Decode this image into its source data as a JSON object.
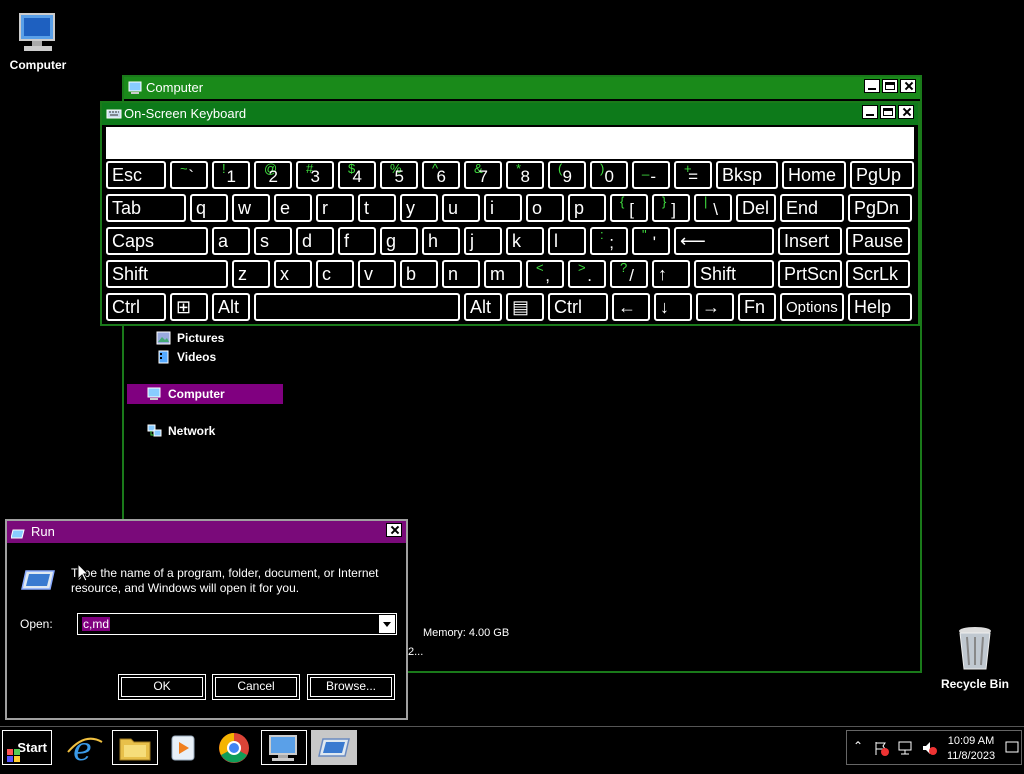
{
  "desktop": {
    "icons": [
      {
        "label": "Computer"
      },
      {
        "label": "Recycle Bin"
      }
    ]
  },
  "explorer": {
    "title": "Computer",
    "nav": {
      "pictures": "Pictures",
      "videos": "Videos",
      "computer": "Computer",
      "network": "Network"
    },
    "details": {
      "memory": "Memory: 4.00 GB",
      "partial": "2..."
    }
  },
  "osk": {
    "title": "On-Screen Keyboard",
    "rows": [
      [
        {
          "main": "Esc"
        },
        {
          "alt": "~",
          "main": "`"
        },
        {
          "alt": "!",
          "main": "1"
        },
        {
          "alt": "@",
          "main": "2"
        },
        {
          "alt": "#",
          "main": "3"
        },
        {
          "alt": "$",
          "main": "4"
        },
        {
          "alt": "%",
          "main": "5"
        },
        {
          "alt": "^",
          "main": "6"
        },
        {
          "alt": "&",
          "main": "7"
        },
        {
          "alt": "*",
          "main": "8"
        },
        {
          "alt": "(",
          "main": "9"
        },
        {
          "alt": ")",
          "main": "0"
        },
        {
          "alt": "_",
          "main": "-"
        },
        {
          "alt": "+",
          "main": "="
        },
        {
          "main": "Bksp"
        },
        {
          "main": "Home"
        },
        {
          "main": "PgUp"
        }
      ],
      [
        {
          "main": "Tab"
        },
        {
          "main": "q"
        },
        {
          "main": "w"
        },
        {
          "main": "e"
        },
        {
          "main": "r"
        },
        {
          "main": "t"
        },
        {
          "main": "y"
        },
        {
          "main": "u"
        },
        {
          "main": "i"
        },
        {
          "main": "o"
        },
        {
          "main": "p"
        },
        {
          "alt": "{",
          "main": "["
        },
        {
          "alt": "}",
          "main": "]"
        },
        {
          "alt": "|",
          "main": "\\"
        },
        {
          "main": "Del"
        },
        {
          "main": "End"
        },
        {
          "main": "PgDn"
        }
      ],
      [
        {
          "main": "Caps"
        },
        {
          "main": "a"
        },
        {
          "main": "s"
        },
        {
          "main": "d"
        },
        {
          "main": "f"
        },
        {
          "main": "g"
        },
        {
          "main": "h"
        },
        {
          "main": "j"
        },
        {
          "main": "k"
        },
        {
          "main": "l"
        },
        {
          "alt": ":",
          "main": ";"
        },
        {
          "alt": "\"",
          "main": "'"
        },
        {
          "main": "⟵"
        },
        {
          "main": "Insert"
        },
        {
          "main": "Pause"
        }
      ],
      [
        {
          "main": "Shift"
        },
        {
          "main": "z"
        },
        {
          "main": "x"
        },
        {
          "main": "c"
        },
        {
          "main": "v"
        },
        {
          "main": "b"
        },
        {
          "main": "n"
        },
        {
          "main": "m"
        },
        {
          "alt": "<",
          "main": ","
        },
        {
          "alt": ">",
          "main": "."
        },
        {
          "alt": "?",
          "main": "/"
        },
        {
          "main": "↑"
        },
        {
          "main": "Shift"
        },
        {
          "main": "PrtScn"
        },
        {
          "main": "ScrLk"
        }
      ],
      [
        {
          "main": "Ctrl"
        },
        {
          "main": "⊞"
        },
        {
          "main": "Alt"
        },
        {
          "main": ""
        },
        {
          "main": "Alt"
        },
        {
          "main": "▤"
        },
        {
          "main": "Ctrl"
        },
        {
          "main": "←"
        },
        {
          "main": "↓"
        },
        {
          "main": "→"
        },
        {
          "main": "Fn"
        },
        {
          "main": "Options"
        },
        {
          "main": "Help"
        }
      ]
    ]
  },
  "run": {
    "title": "Run",
    "description": "Type the name of a program, folder, document, or Internet resource, and Windows will open it for you.",
    "open_label": "Open:",
    "open_value": "c,md",
    "ok": "OK",
    "cancel": "Cancel",
    "browse": "Browse..."
  },
  "taskbar": {
    "start": "Start",
    "pinned": [
      "internet-explorer-icon",
      "file-explorer-icon",
      "media-player-icon",
      "chrome-icon",
      "computer-icon",
      "run-icon"
    ],
    "clock_time": "10:09 AM",
    "clock_date": "11/8/2023"
  },
  "colors": {
    "explorer_title": "#1a8a1a",
    "osk_title": "#0d7a1a",
    "run_title": "#7a0a7a",
    "selection": "#800080",
    "osk_alt_glyph": "#3fdd3f"
  }
}
